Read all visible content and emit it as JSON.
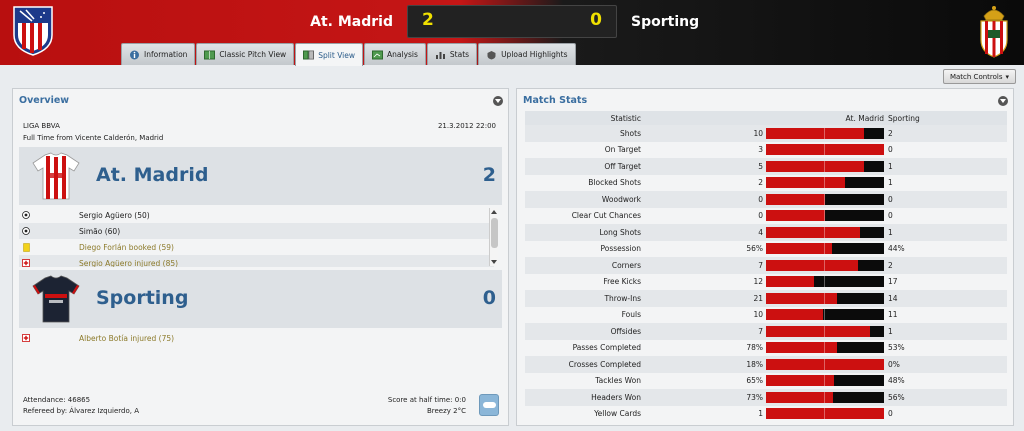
{
  "header": {
    "home_team": "At. Madrid",
    "away_team": "Sporting",
    "home_score": "2",
    "away_score": "0"
  },
  "tabs": [
    {
      "label": "Information",
      "icon": "info-icon"
    },
    {
      "label": "Classic Pitch View",
      "icon": "pitch-icon"
    },
    {
      "label": "Split View",
      "icon": "split-view-icon",
      "active": true
    },
    {
      "label": "Analysis",
      "icon": "analysis-icon"
    },
    {
      "label": "Stats",
      "icon": "stats-icon"
    },
    {
      "label": "Upload Highlights",
      "icon": "upload-icon"
    }
  ],
  "toolbar": {
    "match_controls": "Match Controls"
  },
  "overview": {
    "title": "Overview",
    "competition": "LIGA BBVA",
    "datetime": "21.3.2012 22:00",
    "venue": "Full Time from Vicente Calderón, Madrid",
    "home": {
      "name": "At. Madrid",
      "score": "2",
      "events": [
        {
          "icon": "ball-icon",
          "text": "Sergio Agüero (50)",
          "style": "normal"
        },
        {
          "icon": "ball-icon",
          "text": "Simão (60)",
          "style": "normal"
        },
        {
          "icon": "yellow-card-icon",
          "text": "Diego Forlán booked (59)",
          "style": "gold"
        },
        {
          "icon": "injury-icon",
          "text": "Sergio Agüero injured (85)",
          "style": "gold"
        }
      ]
    },
    "away": {
      "name": "Sporting",
      "score": "0",
      "events": [
        {
          "icon": "injury-icon",
          "text": "Alberto Botía injured (75)",
          "style": "gold"
        }
      ]
    },
    "attendance": "Attendance: 46865",
    "referee": "Refereed by: Álvarez Izquierdo, A",
    "halftime": "Score at half time: 0:0",
    "weather": "Breezy 2°C"
  },
  "stats": {
    "title": "Match Stats",
    "headers": {
      "statistic": "Statistic",
      "home": "At. Madrid",
      "away": "Sporting"
    },
    "rows": [
      {
        "label": "Shots",
        "home": "10",
        "away": "2",
        "home_share": 0.83
      },
      {
        "label": "On Target",
        "home": "3",
        "away": "0",
        "home_share": 1.0
      },
      {
        "label": "Off Target",
        "home": "5",
        "away": "1",
        "home_share": 0.83
      },
      {
        "label": "Blocked Shots",
        "home": "2",
        "away": "1",
        "home_share": 0.67
      },
      {
        "label": "Woodwork",
        "home": "0",
        "away": "0",
        "home_share": 0.5
      },
      {
        "label": "Clear Cut Chances",
        "home": "0",
        "away": "0",
        "home_share": 0.5
      },
      {
        "label": "Long Shots",
        "home": "4",
        "away": "1",
        "home_share": 0.8
      },
      {
        "label": "Possession",
        "home": "56%",
        "away": "44%",
        "home_share": 0.56
      },
      {
        "label": "Corners",
        "home": "7",
        "away": "2",
        "home_share": 0.78
      },
      {
        "label": "Free Kicks",
        "home": "12",
        "away": "17",
        "home_share": 0.41
      },
      {
        "label": "Throw-Ins",
        "home": "21",
        "away": "14",
        "home_share": 0.6
      },
      {
        "label": "Fouls",
        "home": "10",
        "away": "11",
        "home_share": 0.48
      },
      {
        "label": "Offsides",
        "home": "7",
        "away": "1",
        "home_share": 0.88
      },
      {
        "label": "Passes Completed",
        "home": "78%",
        "away": "53%",
        "home_share": 0.6
      },
      {
        "label": "Crosses Completed",
        "home": "18%",
        "away": "0%",
        "home_share": 1.0
      },
      {
        "label": "Tackles Won",
        "home": "65%",
        "away": "48%",
        "home_share": 0.58
      },
      {
        "label": "Headers Won",
        "home": "73%",
        "away": "56%",
        "home_share": 0.57
      },
      {
        "label": "Yellow Cards",
        "home": "1",
        "away": "0",
        "home_share": 1.0
      }
    ]
  },
  "colors": {
    "home_red": "#cc1010",
    "away_black": "#0b0b0b",
    "accent_blue": "#2e5f8e"
  }
}
